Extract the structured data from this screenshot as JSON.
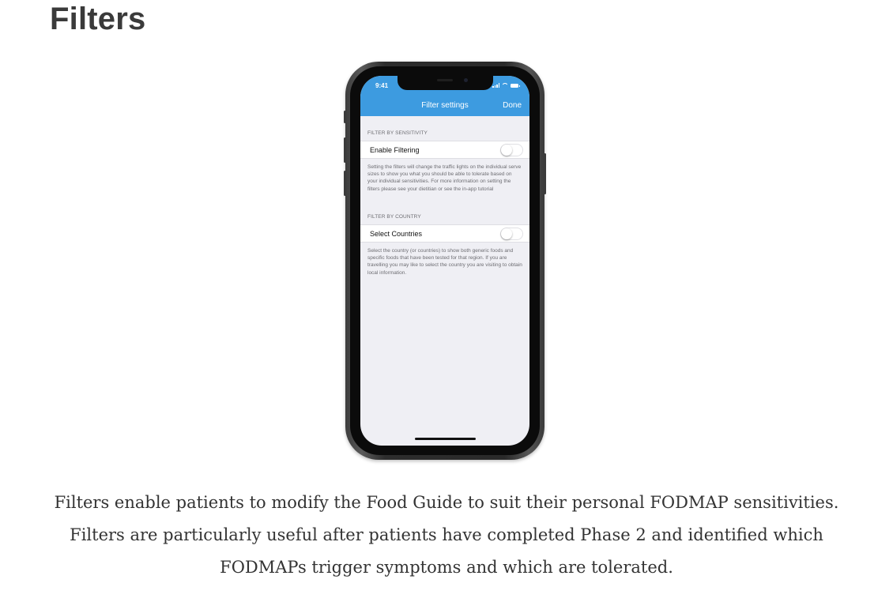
{
  "page": {
    "title": "Filters",
    "caption": "Filters enable patients to modify the Food Guide to suit their personal FODMAP sensitivities. Filters are particularly useful after patients have completed Phase 2 and identified which FODMAPs trigger symptoms and which are tolerated."
  },
  "phone": {
    "status_bar": {
      "time": "9:41",
      "icons": [
        "signal-icon",
        "wifi-icon",
        "battery-icon"
      ]
    },
    "navbar": {
      "title": "Filter settings",
      "done_label": "Done"
    },
    "sections": [
      {
        "header": "FILTER BY SENSITIVITY",
        "row_label": "Enable Filtering",
        "toggle_on": false,
        "footer": "Setting the filters will change the traffic lights on the individual serve sizes to show you what you should be able to tolerate based on your individual sensitivities. For more information on setting the filters please see your dietitian or see the in-app tutorial"
      },
      {
        "header": "FILTER BY COUNTRY",
        "row_label": "Select Countries",
        "toggle_on": false,
        "footer": "Select the country (or countries) to show both generic foods and specific foods that have been tested for that region.  If you are travelling you may like to select the country you are visiting to obtain local information."
      }
    ]
  },
  "colors": {
    "navbar": "#3d9be0",
    "grouped_background": "#efeff4",
    "title_text": "#3a3a3a",
    "caption_text": "#333333"
  }
}
